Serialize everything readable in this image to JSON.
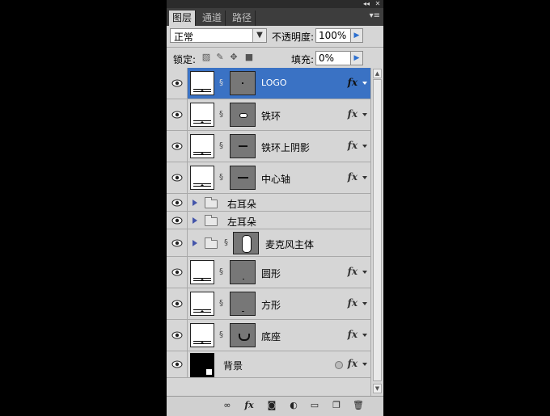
{
  "tabs": [
    {
      "label": "图层",
      "active": true
    },
    {
      "label": "通道",
      "active": false
    },
    {
      "label": "路径",
      "active": false
    }
  ],
  "blend_mode": {
    "value": "正常"
  },
  "opacity": {
    "label": "不透明度:",
    "value": "100%"
  },
  "lock": {
    "label": "锁定:"
  },
  "fill": {
    "label": "填充:",
    "value": "0%"
  },
  "layers": [
    {
      "name": "LOGO",
      "type": "shape",
      "selected": true,
      "fx": "fx"
    },
    {
      "name": "铁环",
      "type": "shape",
      "selected": false,
      "fx": "fx"
    },
    {
      "name": "铁环上阴影",
      "type": "shape",
      "selected": false,
      "fx": "fx"
    },
    {
      "name": "中心轴",
      "type": "shape",
      "selected": false,
      "fx": "fx"
    },
    {
      "name": "右耳朵",
      "type": "group"
    },
    {
      "name": "左耳朵",
      "type": "group"
    },
    {
      "name": "麦克风主体",
      "type": "group-mask"
    },
    {
      "name": "圆形",
      "type": "shape",
      "selected": false,
      "fx": "fx"
    },
    {
      "name": "方形",
      "type": "shape",
      "selected": false,
      "fx": "fx"
    },
    {
      "name": "底座",
      "type": "shape",
      "selected": false,
      "fx": "fx"
    },
    {
      "name": "背景",
      "type": "background",
      "fx": "fx"
    }
  ],
  "icons": {
    "eye": "eye-icon",
    "lock_transparency": "lock-transparent-pixels-icon",
    "lock_image": "lock-image-pixels-icon",
    "lock_position": "lock-position-icon",
    "lock_all": "lock-all-icon",
    "bottom": [
      "link-layers-icon",
      "add-layer-style-icon",
      "add-mask-icon",
      "adjustment-layer-icon",
      "new-group-icon",
      "new-layer-icon",
      "delete-layer-icon"
    ]
  },
  "colors": {
    "selected": "#3a72c4",
    "panel": "#d6d6d6"
  }
}
